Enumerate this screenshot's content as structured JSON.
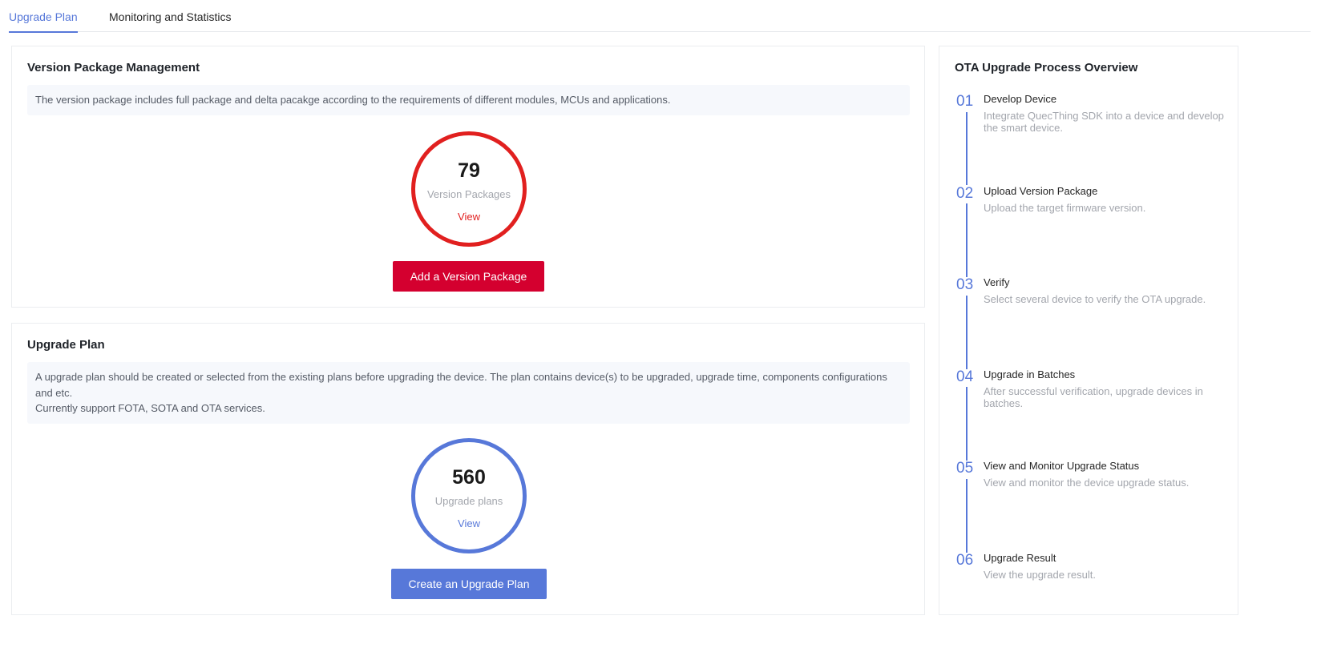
{
  "tabs": [
    {
      "label": "Upgrade Plan",
      "active": true
    },
    {
      "label": "Monitoring and Statistics",
      "active": false
    }
  ],
  "version_package": {
    "title": "Version Package Management",
    "description": "The version package includes full package and delta pacakge according to the requirements of different modules, MCUs and applications.",
    "count": "79",
    "count_label": "Version Packages",
    "view_label": "View",
    "button_label": "Add a Version Package",
    "accent": "#e1201f",
    "button_color": "#d4002f"
  },
  "upgrade_plan": {
    "title": "Upgrade Plan",
    "description_line1": "A upgrade plan should be created or selected from the existing plans before upgrading the device. The plan contains device(s) to be upgraded, upgrade time, components configurations and etc.",
    "description_line2": "Currently support FOTA, SOTA and OTA services.",
    "count": "560",
    "count_label": "Upgrade plans",
    "view_label": "View",
    "button_label": "Create an Upgrade Plan",
    "accent": "#5778d9"
  },
  "ota_overview": {
    "title": "OTA Upgrade Process Overview",
    "steps": [
      {
        "num": "01",
        "title": "Develop Device",
        "desc": "Integrate QuecThing SDK into a device and develop the smart device."
      },
      {
        "num": "02",
        "title": "Upload Version Package",
        "desc": "Upload the target firmware version."
      },
      {
        "num": "03",
        "title": "Verify",
        "desc": "Select several device to verify the OTA upgrade."
      },
      {
        "num": "04",
        "title": "Upgrade in Batches",
        "desc": "After successful verification, upgrade devices in batches."
      },
      {
        "num": "05",
        "title": "View and Monitor Upgrade Status",
        "desc": "View and monitor the device upgrade status."
      },
      {
        "num": "06",
        "title": "Upgrade Result",
        "desc": "View the upgrade result."
      }
    ]
  }
}
